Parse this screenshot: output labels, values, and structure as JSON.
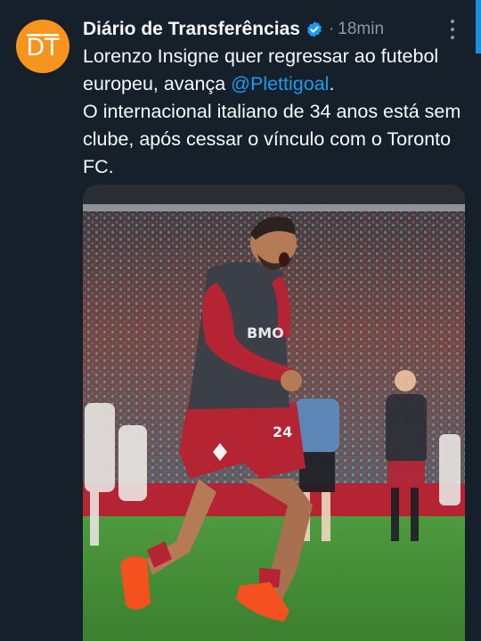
{
  "tweet": {
    "author": {
      "display_name": "Diário de Transferências",
      "verified": true,
      "avatar_text": "DT",
      "avatar_color": "#f7941d"
    },
    "separator": "·",
    "time": "18min",
    "text": {
      "line1_before": "Lorenzo Insigne quer regressar ao futebol europeu, avança ",
      "mention": "@Plettigoal",
      "line1_after": ".",
      "line2": "O internacional italiano de 34 anos está sem clube, após cessar o vínculo com o Toronto FC."
    },
    "media": {
      "jersey_sponsor": "BMO",
      "jersey_number": "24"
    }
  },
  "colors": {
    "background": "#15202b",
    "text": "#f7f9f9",
    "secondary": "#8b98a5",
    "link": "#1d9bf0",
    "brand": "#f7941d"
  }
}
